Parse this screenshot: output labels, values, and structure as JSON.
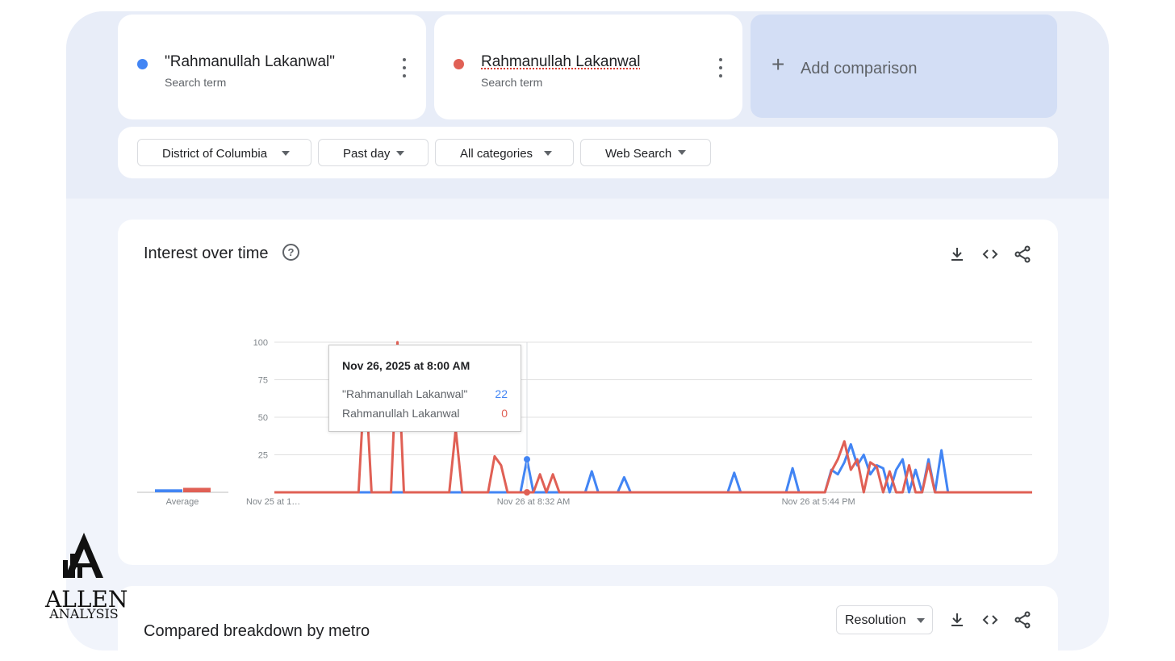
{
  "search_terms": [
    {
      "name": "\"Rahmanullah Lakanwal\"",
      "subtitle": "Search term",
      "color": "#4285f4"
    },
    {
      "name": "Rahmanullah Lakanwal",
      "subtitle": "Search term",
      "color": "#e06055"
    }
  ],
  "add_comparison": {
    "label": "Add comparison"
  },
  "filters": {
    "region": "District of Columbia",
    "time": "Past day",
    "category": "All categories",
    "search_type": "Web Search"
  },
  "interest_card": {
    "title": "Interest over time",
    "help": "?"
  },
  "tooltip": {
    "title": "Nov 26, 2025 at 8:00 AM",
    "rows": [
      {
        "label": "\"Rahmanullah Lakanwal\"",
        "value": "22",
        "color": "#4285f4"
      },
      {
        "label": "Rahmanullah Lakanwal",
        "value": "0",
        "color": "#e06055"
      }
    ]
  },
  "average_label": "Average",
  "chart_data": {
    "type": "line",
    "ylim": [
      0,
      100
    ],
    "y_ticks": [
      "100",
      "75",
      "50",
      "25"
    ],
    "x_tick_labels": [
      "Nov 25 at 1…",
      "Nov 26 at 8:32 AM",
      "Nov 26 at 5:44 PM"
    ],
    "x_tick_index": [
      0,
      40,
      84
    ],
    "grid": true,
    "series": [
      {
        "name": "\"Rahmanullah Lakanwal\"",
        "color": "#4285f4",
        "values": [
          0,
          0,
          0,
          0,
          0,
          0,
          0,
          0,
          0,
          0,
          0,
          0,
          0,
          0,
          0,
          0,
          0,
          0,
          0,
          0,
          0,
          0,
          0,
          0,
          0,
          0,
          0,
          0,
          0,
          0,
          0,
          0,
          0,
          0,
          0,
          0,
          0,
          0,
          0,
          22,
          0,
          0,
          0,
          0,
          0,
          0,
          0,
          0,
          0,
          14,
          0,
          0,
          0,
          0,
          10,
          0,
          0,
          0,
          0,
          0,
          0,
          0,
          0,
          0,
          0,
          0,
          0,
          0,
          0,
          0,
          0,
          13,
          0,
          0,
          0,
          0,
          0,
          0,
          0,
          0,
          16,
          0,
          0,
          0,
          0,
          0,
          15,
          12,
          20,
          32,
          18,
          25,
          12,
          18,
          16,
          0,
          15,
          22,
          0,
          15,
          0,
          22,
          0,
          28,
          0,
          0,
          0,
          0,
          0,
          0,
          0,
          0,
          0,
          0,
          0,
          0,
          0,
          0
        ]
      },
      {
        "name": "Rahmanullah Lakanwal",
        "color": "#e06055",
        "values": [
          0,
          0,
          0,
          0,
          0,
          0,
          0,
          0,
          0,
          0,
          0,
          0,
          0,
          0,
          80,
          0,
          0,
          0,
          0,
          100,
          0,
          0,
          0,
          0,
          0,
          0,
          0,
          0,
          42,
          0,
          0,
          0,
          0,
          0,
          24,
          18,
          0,
          0,
          0,
          0,
          0,
          12,
          0,
          12,
          0,
          0,
          0,
          0,
          0,
          0,
          0,
          0,
          0,
          0,
          0,
          0,
          0,
          0,
          0,
          0,
          0,
          0,
          0,
          0,
          0,
          0,
          0,
          0,
          0,
          0,
          0,
          0,
          0,
          0,
          0,
          0,
          0,
          0,
          0,
          0,
          0,
          0,
          0,
          0,
          0,
          0,
          14,
          22,
          34,
          15,
          22,
          0,
          20,
          17,
          0,
          14,
          0,
          0,
          18,
          0,
          0,
          19,
          0,
          0,
          0,
          0,
          0,
          0,
          0,
          0,
          0,
          0,
          0,
          0,
          0,
          0,
          0,
          0
        ]
      }
    ],
    "averages": [
      2,
      3
    ]
  },
  "metro_card": {
    "title": "Compared breakdown by metro",
    "resolution_label": "Resolution"
  },
  "logo": {
    "line1": "ALLEN",
    "line2": "ANALYSIS"
  }
}
